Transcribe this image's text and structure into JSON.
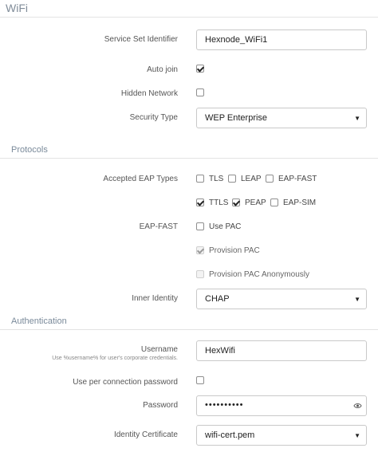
{
  "sections": {
    "wifi": "WiFi",
    "protocols": "Protocols",
    "authentication": "Authentication"
  },
  "ssid": {
    "label": "Service Set Identifier",
    "value": "Hexnode_WiFi1"
  },
  "auto_join": {
    "label": "Auto join",
    "checked": true
  },
  "hidden_network": {
    "label": "Hidden Network",
    "checked": false
  },
  "security_type": {
    "label": "Security Type",
    "value": "WEP Enterprise"
  },
  "eap_types": {
    "label": "Accepted EAP Types",
    "options": [
      {
        "label": "TLS",
        "checked": false
      },
      {
        "label": "LEAP",
        "checked": false
      },
      {
        "label": "EAP-FAST",
        "checked": false
      },
      {
        "label": "TTLS",
        "checked": true
      },
      {
        "label": "PEAP",
        "checked": true
      },
      {
        "label": "EAP-SIM",
        "checked": false
      }
    ]
  },
  "eap_fast": {
    "label": "EAP-FAST",
    "use_pac": {
      "label": "Use PAC",
      "checked": false
    },
    "provision_pac": {
      "label": "Provision PAC",
      "checked": true,
      "disabled": true
    },
    "provision_pac_anon": {
      "label": "Provision PAC Anonymously",
      "checked": false,
      "disabled": true
    }
  },
  "inner_identity": {
    "label": "Inner Identity",
    "value": "CHAP"
  },
  "username": {
    "label": "Username",
    "hint": "Use %username% for user's corporate credentials.",
    "value": "HexWifi"
  },
  "per_connection_password": {
    "label": "Use per connection password",
    "checked": false
  },
  "password": {
    "label": "Password",
    "masked": "••••••••••"
  },
  "identity_certificate": {
    "label": "Identity Certificate",
    "value": "wifi-cert.pem"
  },
  "icons": {
    "dropdown": "caret-down-icon",
    "reveal": "eye-icon",
    "checkbox": "checkmark-icon"
  },
  "colors": {
    "section_text": "#7a8a9a",
    "border": "#c9c9c9",
    "divider": "#e3e3e3"
  }
}
